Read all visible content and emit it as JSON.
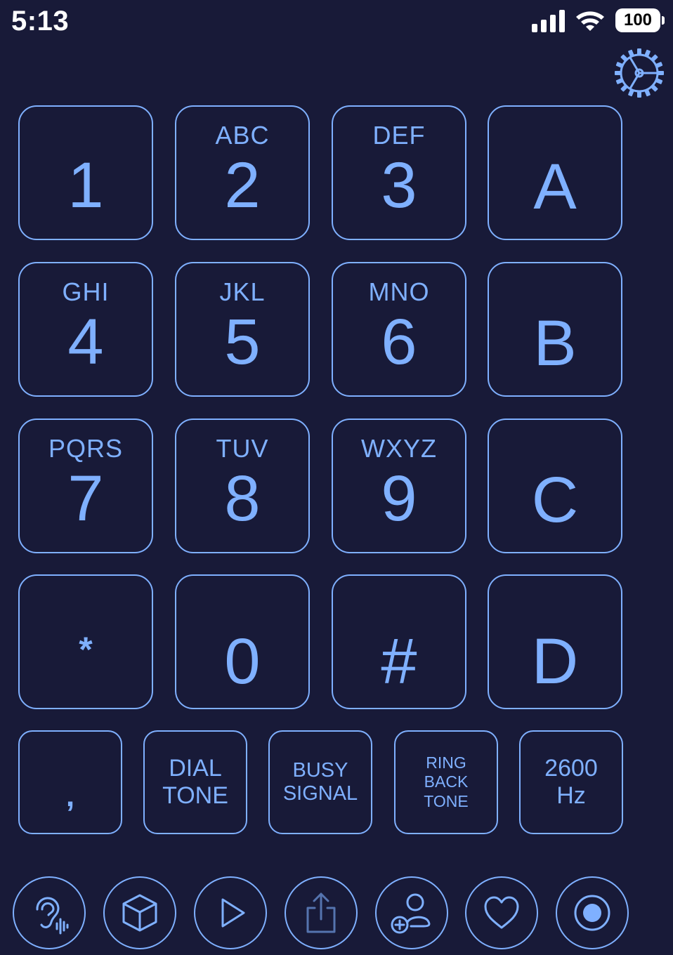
{
  "status": {
    "time": "5:13",
    "battery": "100"
  },
  "icons": {
    "settings": "gear-icon",
    "bottom": [
      "hearing-icon",
      "cube-icon",
      "play-icon",
      "share-icon",
      "add-contact-icon",
      "heart-icon",
      "record-icon"
    ]
  },
  "colors": {
    "background": "#181a38",
    "accent": "#7fb0ff"
  },
  "keypad": {
    "k1": {
      "digit": "1",
      "letters": ""
    },
    "k2": {
      "digit": "2",
      "letters": "ABC"
    },
    "k3": {
      "digit": "3",
      "letters": "DEF"
    },
    "kA": {
      "digit": "A"
    },
    "k4": {
      "digit": "4",
      "letters": "GHI"
    },
    "k5": {
      "digit": "5",
      "letters": "JKL"
    },
    "k6": {
      "digit": "6",
      "letters": "MNO"
    },
    "kB": {
      "digit": "B"
    },
    "k7": {
      "digit": "7",
      "letters": "PQRS"
    },
    "k8": {
      "digit": "8",
      "letters": "TUV"
    },
    "k9": {
      "digit": "9",
      "letters": "WXYZ"
    },
    "kC": {
      "digit": "C"
    },
    "kstar": {
      "digit": "*"
    },
    "k0": {
      "digit": "0"
    },
    "khash": {
      "digit": "#"
    },
    "kD": {
      "digit": "D"
    }
  },
  "tones": {
    "pause": {
      "label": ","
    },
    "dial": {
      "line1": "DIAL",
      "line2": "TONE"
    },
    "busy": {
      "line1": "BUSY",
      "line2": "SIGNAL"
    },
    "ringback": {
      "line1": "RING",
      "line2": "BACK",
      "line3": "TONE"
    },
    "freq": {
      "line1": "2600",
      "line2": "Hz"
    }
  }
}
